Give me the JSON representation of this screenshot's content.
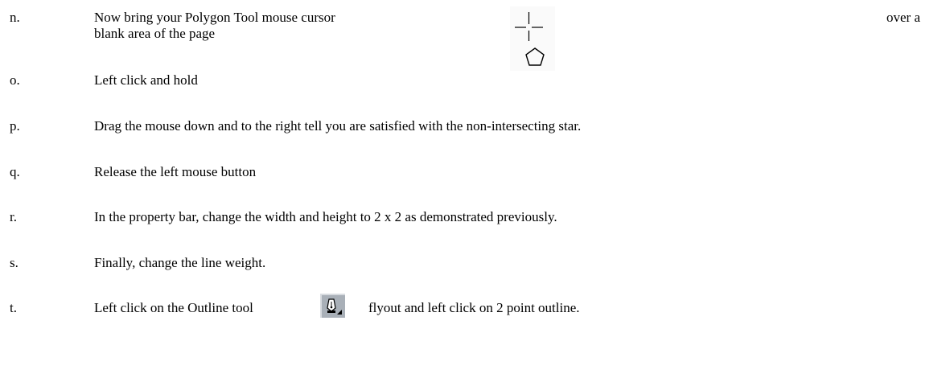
{
  "steps": [
    {
      "id": "n",
      "marker": "n.",
      "text_line1": "Now bring your Polygon Tool mouse cursor",
      "text_trailing": "over a",
      "text_line2": "blank area of the page",
      "icon": "polygon-tool-cursor-icon"
    },
    {
      "id": "o",
      "marker": "o.",
      "text": "Left click and hold"
    },
    {
      "id": "p",
      "marker": "p.",
      "text": "Drag the mouse down and to the right tell you are satisfied with the non-intersecting star."
    },
    {
      "id": "q",
      "marker": "q.",
      "text": "Release the left mouse button"
    },
    {
      "id": "r",
      "marker": "r.",
      "text": "In the property bar, change the width and height to 2 x 2 as demonstrated previously."
    },
    {
      "id": "s",
      "marker": "s.",
      "text": "Finally, change the line weight."
    },
    {
      "id": "t",
      "marker": "t.",
      "text_before": "Left click on the Outline tool",
      "text_after": "flyout and left click on 2 point outline.",
      "icon": "outline-pen-tool-icon"
    }
  ],
  "colors": {
    "text": "#000000",
    "icon_button_face": "#a9b0b8",
    "icon_button_light": "#d8dce0",
    "cursor_background": "#fafafa"
  }
}
